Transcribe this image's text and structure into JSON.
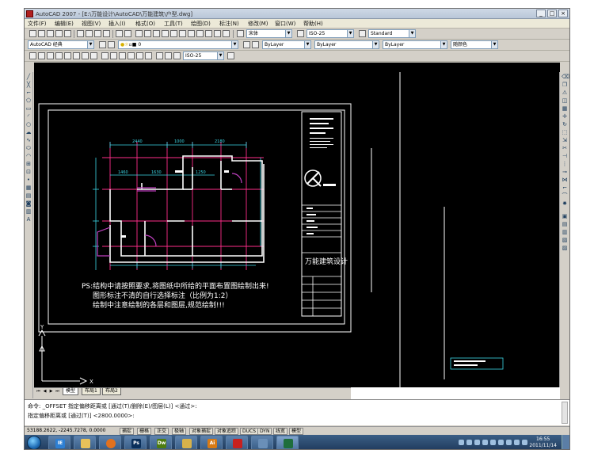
{
  "window": {
    "title": "AutoCAD 2007 - [E:\\万能设计\\AutoCAD\\万能建筑\\户型.dwg]",
    "controls": [
      "_",
      "□",
      "×"
    ]
  },
  "menu": [
    "文件(F)",
    "编辑(E)",
    "视图(V)",
    "插入(I)",
    "格式(O)",
    "工具(T)",
    "绘图(D)",
    "标注(N)",
    "修改(M)",
    "窗口(W)",
    "帮助(H)"
  ],
  "toolbar2": {
    "text_style": "宋体",
    "dim_style": "ISO-25",
    "table_style": "Standard"
  },
  "toolbar3": {
    "workspace": "AutoCAD 经典",
    "layer": "0",
    "color": "ByLayer",
    "linetype": "ByLayer",
    "lineweight": "ByLayer",
    "plot_style": "随颜色"
  },
  "toolbar4": {
    "dim_style": "ISO-25"
  },
  "drawing": {
    "dim_top": [
      "2440",
      "1000",
      "2180"
    ],
    "dim_sub": [
      "1460",
      "1630",
      "1250"
    ],
    "note_line1": "PS:结构中请按照要求,将图纸中所给的平面布置图绘制出来!",
    "note_line2": "图形标注不清的自行选择标注（比例为1:2）",
    "note_line3": "绘制中注意绘制的各层和图层,规范绘制!!!",
    "title_block_caption": "万能建筑设计",
    "ucs_y": "Y",
    "ucs_x": "X"
  },
  "tabs": {
    "model": "模型",
    "layout1": "布局1",
    "layout2": "布局2"
  },
  "command": {
    "line1": "命令: _OFFSET  指定偏移距离或 [通过(T)/删除(E)/图层(L)] <通过>:",
    "line2": "指定偏移距离或 [通过(T)] <2800.0000>:"
  },
  "status": {
    "coords": "53188.2622, -2245.7278, 0.0000",
    "toggles": [
      "捕捉",
      "栅格",
      "正交",
      "极轴",
      "对象捕捉",
      "对象追踪",
      "DUCS",
      "DYN",
      "线宽",
      "模型"
    ]
  },
  "taskbar": {
    "apps": [
      "IE",
      "Explorer",
      "Firefox",
      "Ps",
      "Dw",
      "Acd",
      "Ai",
      "Acrobat",
      "Tool",
      "AutoCAD"
    ],
    "time": "16:55",
    "date": "2011/11/14"
  },
  "colors": {
    "canvas_bg": "#000000",
    "wall": "#ffffff",
    "grid": "#ff2e8a",
    "dimension": "#3cd7e6",
    "note_text": "#ffffff",
    "door": "#c040c0"
  }
}
